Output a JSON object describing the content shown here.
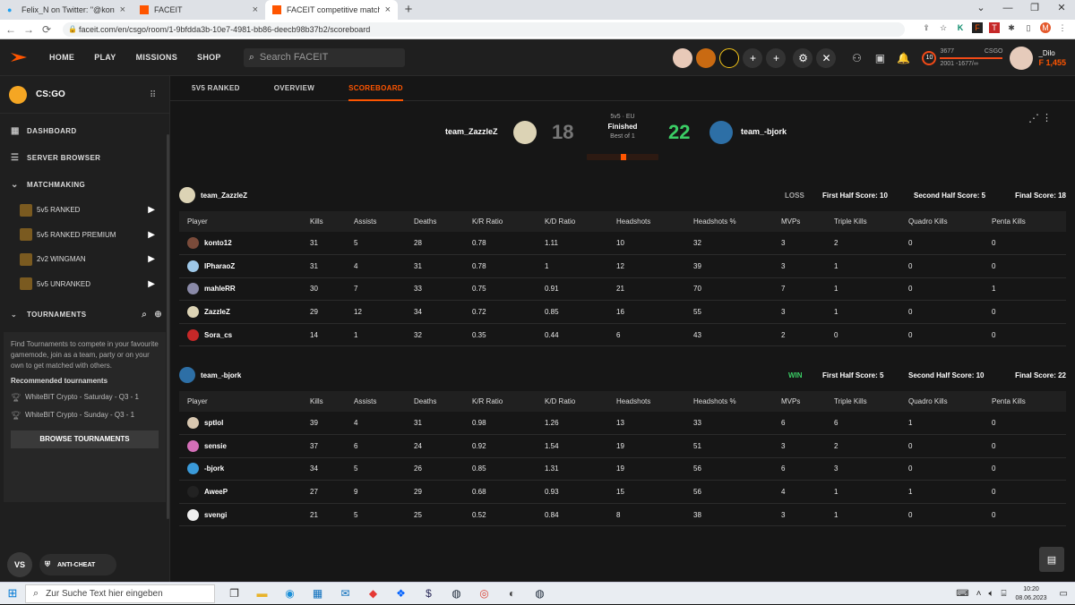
{
  "browser": {
    "tabs": [
      {
        "title": "Felix_N on Twitter: \"@konto_12 …",
        "icon": "twitter-icon"
      },
      {
        "title": "FACEIT",
        "icon": "faceit-icon"
      },
      {
        "title": "FACEIT competitive match - FAC…",
        "icon": "faceit-icon"
      }
    ],
    "url": "faceit.com/en/csgo/room/1-9bfdda3b-10e7-4981-bb86-deecb98b37b2/scoreboard"
  },
  "topnav": {
    "links": [
      "HOME",
      "PLAY",
      "MISSIONS",
      "SHOP"
    ],
    "search_placeholder": "Search FACEIT",
    "level": "10",
    "elo_top": "3677",
    "elo_game": "CSGO",
    "elo_bottom": "2001 -1677/∞",
    "user_name": "_Dilo",
    "user_points": "1,455",
    "accent": "#ff5500"
  },
  "sidebar": {
    "game": "CS:GO",
    "dashboard": "DASHBOARD",
    "server_browser": "SERVER BROWSER",
    "matchmaking": "MATCHMAKING",
    "mm_items": [
      "5v5 RANKED",
      "5v5 RANKED PREMIUM",
      "2v2 WINGMAN",
      "5v5 UNRANKED"
    ],
    "tournaments": "TOURNAMENTS",
    "tourn_desc": "Find Tournaments to compete in your favourite gamemode, join as a team, party or on your own to get matched with others.",
    "recommended": "Recommended tournaments",
    "tourn_items": [
      "WhiteBIT Crypto - Saturday - Q3 - 1",
      "WhiteBIT Crypto - Sunday - Q3 - 1"
    ],
    "browse": "BROWSE TOURNAMENTS",
    "vs": "VS",
    "anticheat": "ANTI-CHEAT"
  },
  "subtabs": [
    "5V5 RANKED",
    "OVERVIEW",
    "SCOREBOARD"
  ],
  "match": {
    "team1": "team_ZazzleZ",
    "score1": "18",
    "mode": "5v5 · EU",
    "status": "Finished",
    "format": "Best of 1",
    "score2": "22",
    "team2": "team_-bjork"
  },
  "columns": [
    "Player",
    "Kills",
    "Assists",
    "Deaths",
    "K/R Ratio",
    "K/D Ratio",
    "Headshots",
    "Headshots %",
    "MVPs",
    "Triple Kills",
    "Quadro Kills",
    "Penta Kills"
  ],
  "teams": [
    {
      "name": "team_ZazzleZ",
      "result": "LOSS",
      "result_color": "#aaaaaa",
      "half1": "First Half Score: 10",
      "half2": "Second Half Score: 5",
      "final": "Final Score: 18",
      "players": [
        [
          "konto12",
          "31",
          "5",
          "28",
          "0.78",
          "1.11",
          "10",
          "32",
          "3",
          "2",
          "0",
          "0"
        ],
        [
          "IPharaoZ",
          "31",
          "4",
          "31",
          "0.78",
          "1",
          "12",
          "39",
          "3",
          "1",
          "0",
          "0"
        ],
        [
          "mahleRR",
          "30",
          "7",
          "33",
          "0.75",
          "0.91",
          "21",
          "70",
          "7",
          "1",
          "0",
          "1"
        ],
        [
          "ZazzleZ",
          "29",
          "12",
          "34",
          "0.72",
          "0.85",
          "16",
          "55",
          "3",
          "1",
          "0",
          "0"
        ],
        [
          "Sora_cs",
          "14",
          "1",
          "32",
          "0.35",
          "0.44",
          "6",
          "43",
          "2",
          "0",
          "0",
          "0"
        ]
      ]
    },
    {
      "name": "team_-bjork",
      "result": "WIN",
      "result_color": "#3bcd65",
      "half1": "First Half Score: 5",
      "half2": "Second Half Score: 10",
      "final": "Final Score: 22",
      "players": [
        [
          "sptlol",
          "39",
          "4",
          "31",
          "0.98",
          "1.26",
          "13",
          "33",
          "6",
          "6",
          "1",
          "0"
        ],
        [
          "sensie",
          "37",
          "6",
          "24",
          "0.92",
          "1.54",
          "19",
          "51",
          "3",
          "2",
          "0",
          "0"
        ],
        [
          "-bjork",
          "34",
          "5",
          "26",
          "0.85",
          "1.31",
          "19",
          "56",
          "6",
          "3",
          "0",
          "0"
        ],
        [
          "AweeP",
          "27",
          "9",
          "29",
          "0.68",
          "0.93",
          "15",
          "56",
          "4",
          "1",
          "1",
          "0"
        ],
        [
          "svengi",
          "21",
          "5",
          "25",
          "0.52",
          "0.84",
          "8",
          "38",
          "3",
          "1",
          "0",
          "0"
        ]
      ]
    }
  ],
  "taskbar": {
    "search": "Zur Suche Text hier eingeben",
    "time": "10:20",
    "date": "08.06.2023"
  }
}
